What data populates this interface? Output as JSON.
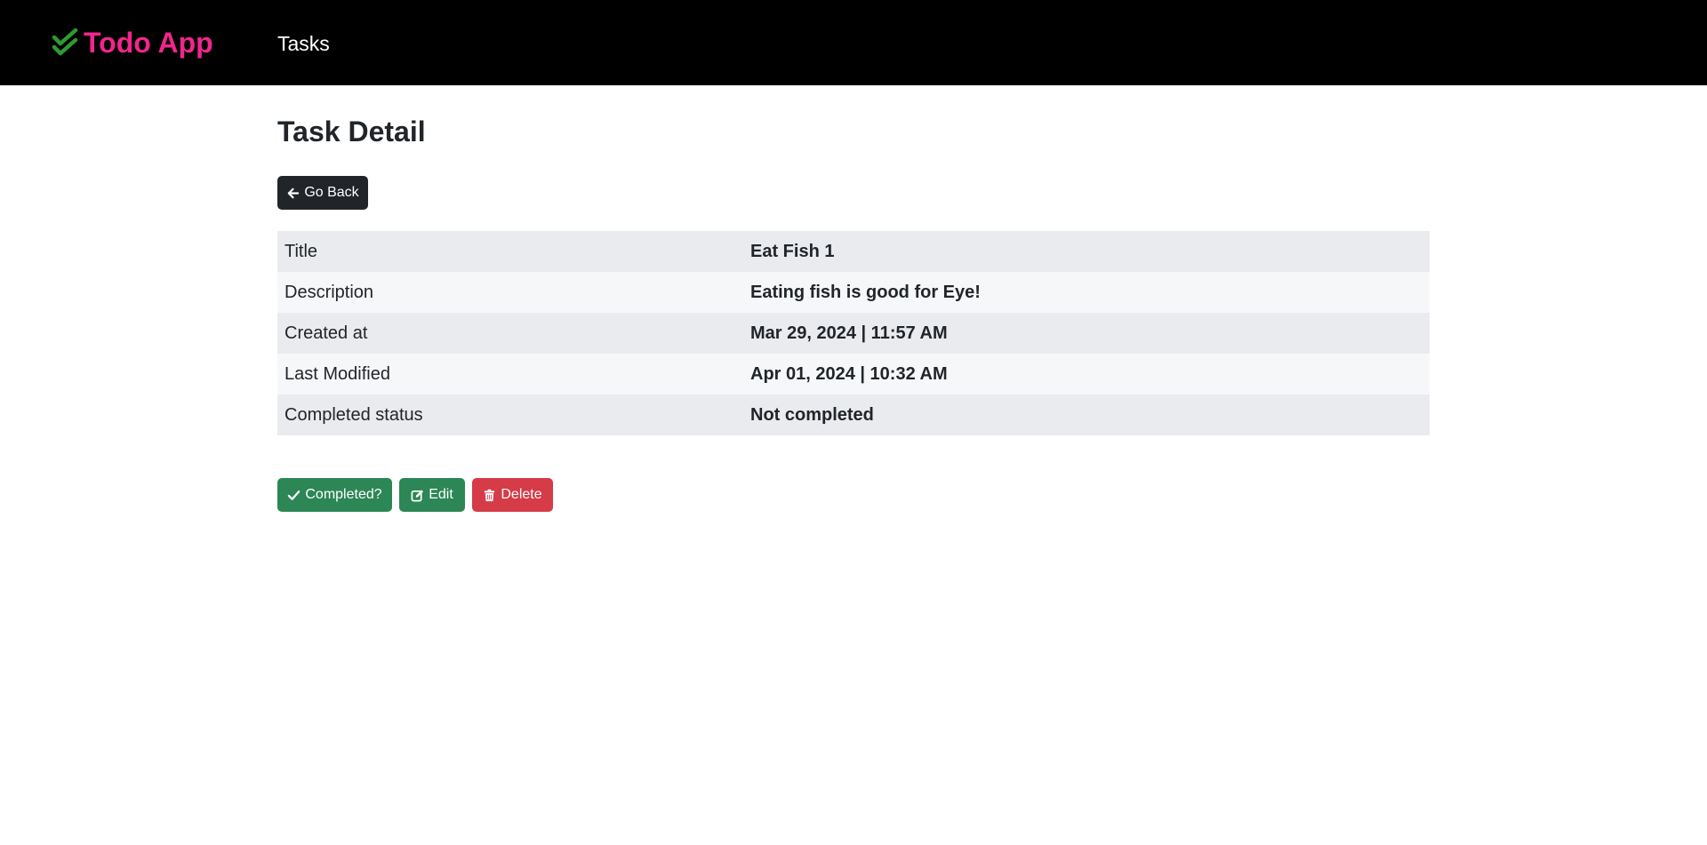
{
  "navbar": {
    "brand_text": "Todo App",
    "brand_icon": "double-check-icon",
    "nav_link": "Tasks"
  },
  "colors": {
    "navbar_bg": "#000000",
    "brand_text": "#f0268c",
    "brand_icon": "#2f9a2f",
    "dark_button": "#212529",
    "success_button": "#2c8656",
    "danger_button": "#d63b48"
  },
  "page": {
    "title": "Task Detail"
  },
  "buttons": {
    "back_label": "Go Back",
    "back_icon": "arrow-left-icon",
    "complete_label": "Completed?",
    "complete_icon": "check-icon",
    "edit_label": "Edit",
    "edit_icon": "edit-icon",
    "delete_label": "Delete",
    "delete_icon": "trash-icon"
  },
  "details": [
    {
      "label": "Title",
      "value": "Eat Fish 1"
    },
    {
      "label": "Description",
      "value": "Eating fish is good for Eye!"
    },
    {
      "label": "Created at",
      "value": "Mar 29, 2024 | 11:57 AM"
    },
    {
      "label": "Last Modified",
      "value": "Apr 01, 2024 | 10:32 AM"
    },
    {
      "label": "Completed status",
      "value": "Not completed"
    }
  ]
}
